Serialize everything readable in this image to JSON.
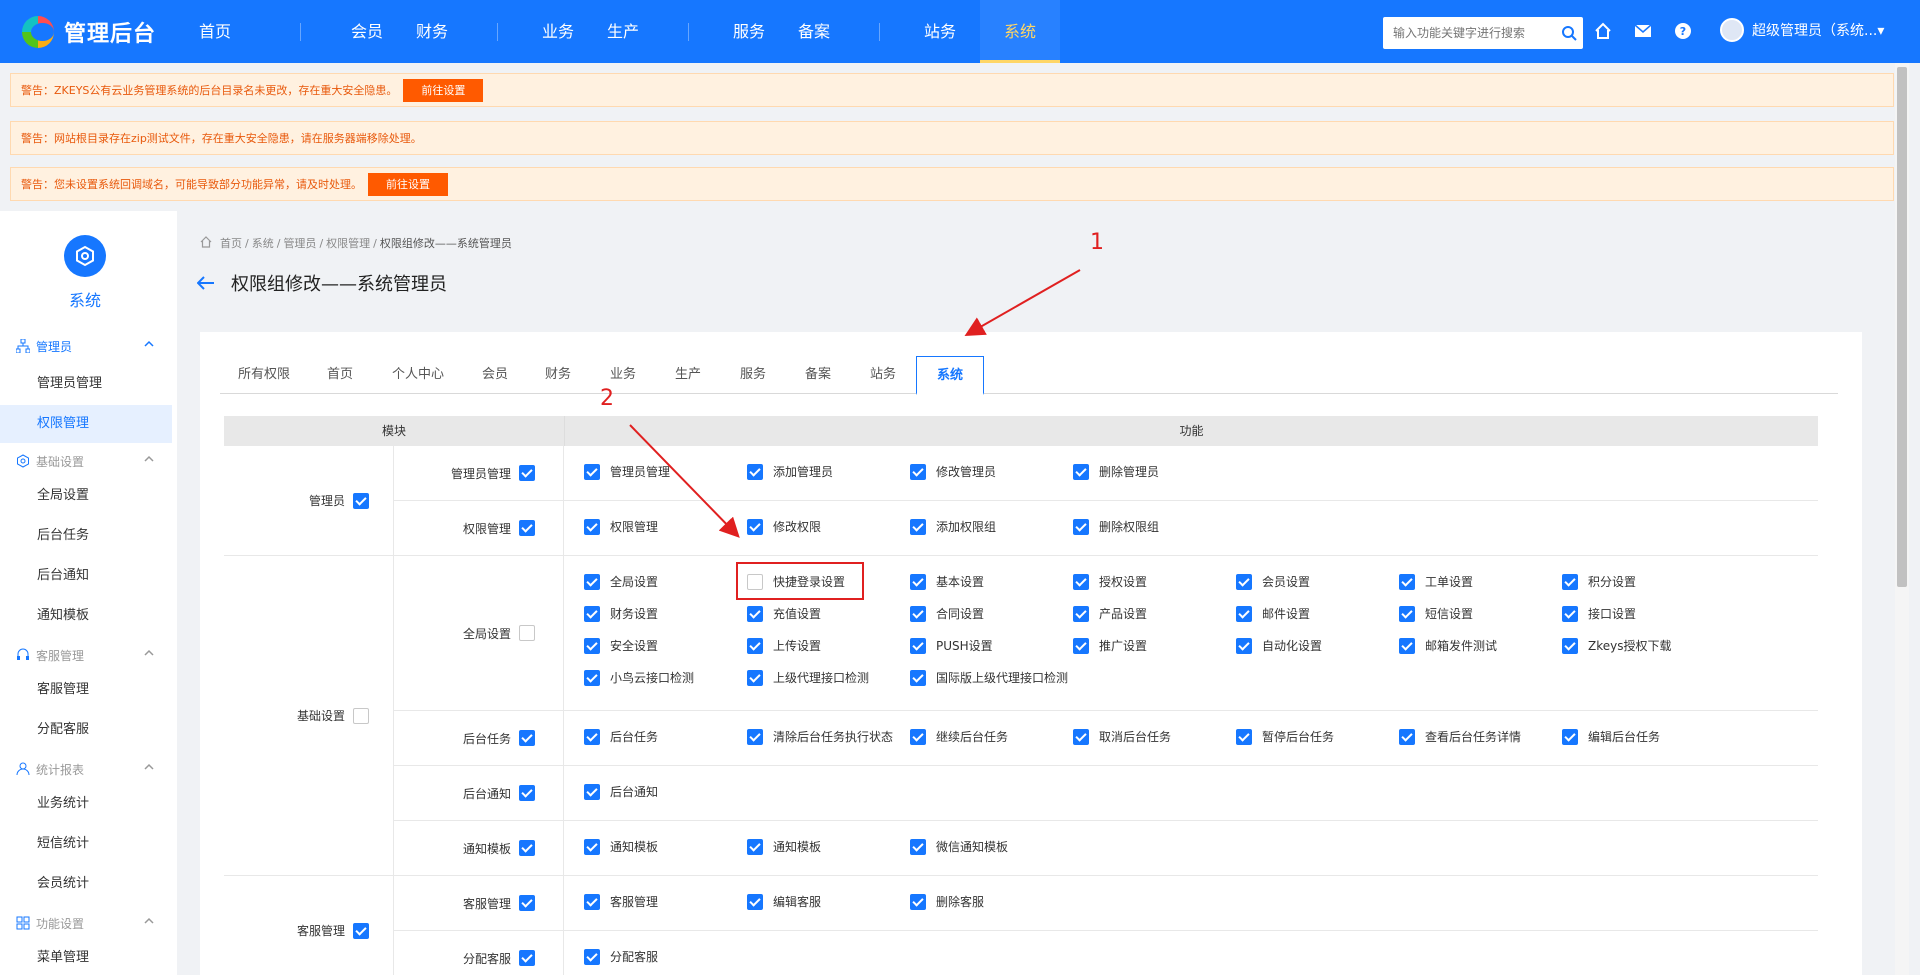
{
  "header": {
    "logo_text": "管理后台",
    "nav": [
      "首页",
      "会员",
      "财务",
      "业务",
      "生产",
      "服务",
      "备案",
      "站务",
      "系统"
    ],
    "active_nav": "系统",
    "search_placeholder": "输入功能关键字进行搜索",
    "user": "超级管理员（系统...▾"
  },
  "alerts": [
    {
      "text": "警告：ZKEYS公有云业务管理系统的后台目录名未更改，存在重大安全隐患。",
      "button": "前往设置"
    },
    {
      "text": "警告：网站根目录存在zip测试文件，存在重大安全隐患，请在服务器端移除处理。",
      "button": ""
    },
    {
      "text": "警告：您未设置系统回调域名，可能导致部分功能异常，请及时处理。",
      "button": "前往设置"
    }
  ],
  "sidebar": {
    "title": "系统",
    "groups": [
      {
        "label": "管理员",
        "open": true,
        "items": [
          "管理员管理",
          "权限管理"
        ]
      },
      {
        "label": "基础设置",
        "open": false,
        "items": [
          "全局设置",
          "后台任务",
          "后台通知",
          "通知模板"
        ]
      },
      {
        "label": "客服管理",
        "open": false,
        "items": [
          "客服管理",
          "分配客服"
        ]
      },
      {
        "label": "统计报表",
        "open": false,
        "items": [
          "业务统计",
          "短信统计",
          "会员统计"
        ]
      },
      {
        "label": "功能设置",
        "open": false,
        "items": [
          "菜单管理"
        ]
      }
    ],
    "active_item": "权限管理"
  },
  "breadcrumb": [
    "首页",
    "/",
    "系统",
    "/",
    "管理员",
    "/",
    "权限管理",
    "/",
    "权限组修改——系统管理员"
  ],
  "page_title": "权限组修改——系统管理员",
  "tabs": [
    "所有权限",
    "首页",
    "个人中心",
    "会员",
    "财务",
    "业务",
    "生产",
    "服务",
    "备案",
    "站务",
    "系统"
  ],
  "active_tab": "系统",
  "table": {
    "col_module": "模块",
    "col_function": "功能",
    "modules": [
      {
        "name": "管理员",
        "checked": true,
        "subs": [
          {
            "name": "管理员管理",
            "checked": true,
            "functions": [
              [
                "管理员管理",
                true
              ],
              [
                "添加管理员",
                true
              ],
              [
                "修改管理员",
                true
              ],
              [
                "删除管理员",
                true
              ]
            ]
          },
          {
            "name": "权限管理",
            "checked": true,
            "functions": [
              [
                "权限管理",
                true
              ],
              [
                "修改权限",
                true
              ],
              [
                "添加权限组",
                true
              ],
              [
                "删除权限组",
                true
              ]
            ]
          }
        ]
      },
      {
        "name": "基础设置",
        "checked": false,
        "subs": [
          {
            "name": "全局设置",
            "checked": false,
            "functions": [
              [
                "全局设置",
                true
              ],
              [
                "快捷登录设置",
                false
              ],
              [
                "基本设置",
                true
              ],
              [
                "授权设置",
                true
              ],
              [
                "会员设置",
                true
              ],
              [
                "工单设置",
                true
              ],
              [
                "积分设置",
                true
              ],
              [
                "财务设置",
                true
              ],
              [
                "充值设置",
                true
              ],
              [
                "合同设置",
                true
              ],
              [
                "产品设置",
                true
              ],
              [
                "邮件设置",
                true
              ],
              [
                "短信设置",
                true
              ],
              [
                "接口设置",
                true
              ],
              [
                "安全设置",
                true
              ],
              [
                "上传设置",
                true
              ],
              [
                "PUSH设置",
                true
              ],
              [
                "推广设置",
                true
              ],
              [
                "自动化设置",
                true
              ],
              [
                "邮箱发件测试",
                true
              ],
              [
                "Zkeys授权下载",
                true
              ],
              [
                "小鸟云接口检测",
                true
              ],
              [
                "上级代理接口检测",
                true
              ],
              [
                "国际版上级代理接口检测",
                true
              ]
            ]
          },
          {
            "name": "后台任务",
            "checked": true,
            "functions": [
              [
                "后台任务",
                true
              ],
              [
                "清除后台任务执行状态",
                true
              ],
              [
                "继续后台任务",
                true
              ],
              [
                "取消后台任务",
                true
              ],
              [
                "暂停后台任务",
                true
              ],
              [
                "查看后台任务详情",
                true
              ],
              [
                "编辑后台任务",
                true
              ]
            ]
          },
          {
            "name": "后台通知",
            "checked": true,
            "functions": [
              [
                "后台通知",
                true
              ]
            ]
          },
          {
            "name": "通知模板",
            "checked": true,
            "functions": [
              [
                "通知模板",
                true
              ],
              [
                "通知模板",
                true
              ],
              [
                "微信通知模板",
                true
              ]
            ]
          }
        ]
      },
      {
        "name": "客服管理",
        "checked": true,
        "subs": [
          {
            "name": "客服管理",
            "checked": true,
            "functions": [
              [
                "客服管理",
                true
              ],
              [
                "编辑客服",
                true
              ],
              [
                "删除客服",
                true
              ]
            ]
          },
          {
            "name": "分配客服",
            "checked": true,
            "functions": [
              [
                "分配客服",
                true
              ]
            ]
          }
        ]
      }
    ]
  },
  "annotations": [
    "1",
    "2"
  ],
  "colors": {
    "primary": "#1677ff",
    "warning_bg": "#fff1e0",
    "warning_text": "#e8590c",
    "warning_button": "#ff5a00",
    "annotation": "#e02020"
  }
}
